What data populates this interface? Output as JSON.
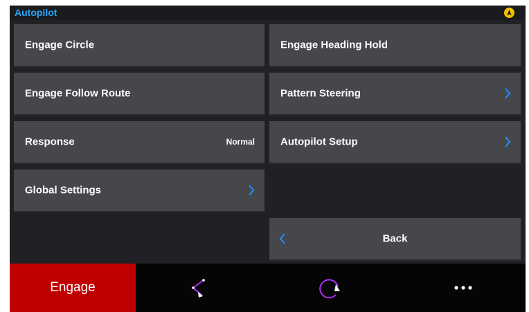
{
  "header": {
    "title": "Autopilot",
    "status_icon": "autopilot-badge-icon",
    "badge_color": "#f5c000"
  },
  "menu": {
    "engage_circle": "Engage Circle",
    "engage_heading_hold": "Engage Heading Hold",
    "engage_follow_route": "Engage Follow Route",
    "pattern_steering": "Pattern Steering",
    "response": "Response",
    "response_value": "Normal",
    "autopilot_setup": "Autopilot Setup",
    "global_settings": "Global Settings",
    "back": "Back"
  },
  "bottom_bar": {
    "engage_label": "Engage",
    "engage_color": "#c00000",
    "icons": [
      "route-pattern-icon",
      "circle-pattern-icon",
      "more-options-icon"
    ],
    "accent_color": "#b030ff"
  },
  "colors": {
    "tile": "#45474b",
    "background": "#1f2125",
    "chevron": "#1e90ff",
    "title": "#29a8ff"
  }
}
